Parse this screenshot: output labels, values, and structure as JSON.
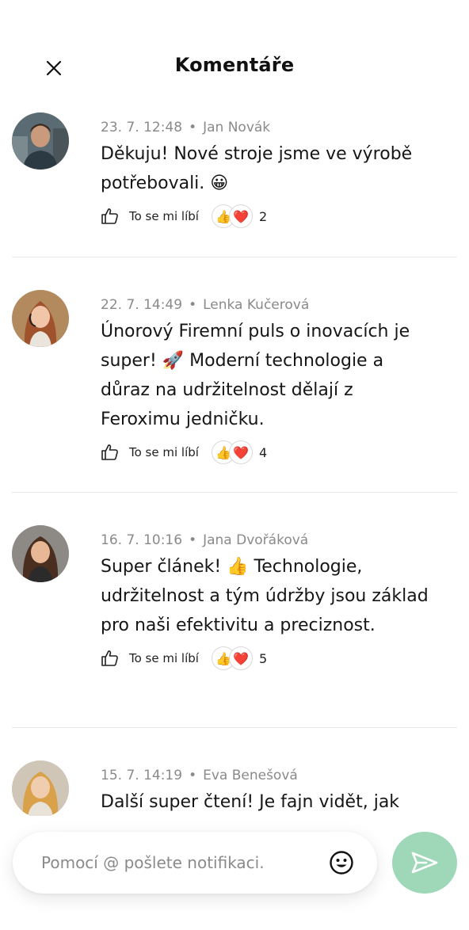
{
  "header": {
    "title": "Komentáře"
  },
  "comments": [
    {
      "date": "23. 7. 12:48",
      "author": "Jan Novák",
      "text": "Děkuju! Nové stroje jsme ve výrobě potřebovali. 😀",
      "like_label": "To se mi líbí",
      "reactions": [
        "👍",
        "❤️"
      ],
      "reaction_count": "2"
    },
    {
      "date": "22. 7. 14:49",
      "author": "Lenka Kučerová",
      "text": "Únorový Firemní puls o inovacích je super! 🚀 Moderní technologie a důraz na udržitelnost dělají z Feroximu jedničku.",
      "like_label": "To se mi líbí",
      "reactions": [
        "👍",
        "❤️"
      ],
      "reaction_count": "4"
    },
    {
      "date": "16. 7. 10:16",
      "author": "Jana Dvořáková",
      "text": "Super článek! 👍 Technologie, udržitelnost a tým údržby jsou základ pro naši efektivitu a preciznost.",
      "like_label": "To se mi líbí",
      "reactions": [
        "👍",
        "❤️"
      ],
      "reaction_count": "5"
    },
    {
      "date": "15. 7. 14:19",
      "author": "Eva Benešová",
      "text": "Další super čtení! Je fajn vidět, jak"
    }
  ],
  "composer": {
    "placeholder": "Pomocí @ pošlete notifikaci."
  },
  "colors": {
    "send_button": "#9fd8b9",
    "divider": "#e6e6e6",
    "meta_text": "#8a8a8a"
  },
  "icons": {
    "close": "close-icon",
    "like": "thumbs-up-outline-icon",
    "emoji": "smiley-icon",
    "send": "send-arrow-icon"
  }
}
